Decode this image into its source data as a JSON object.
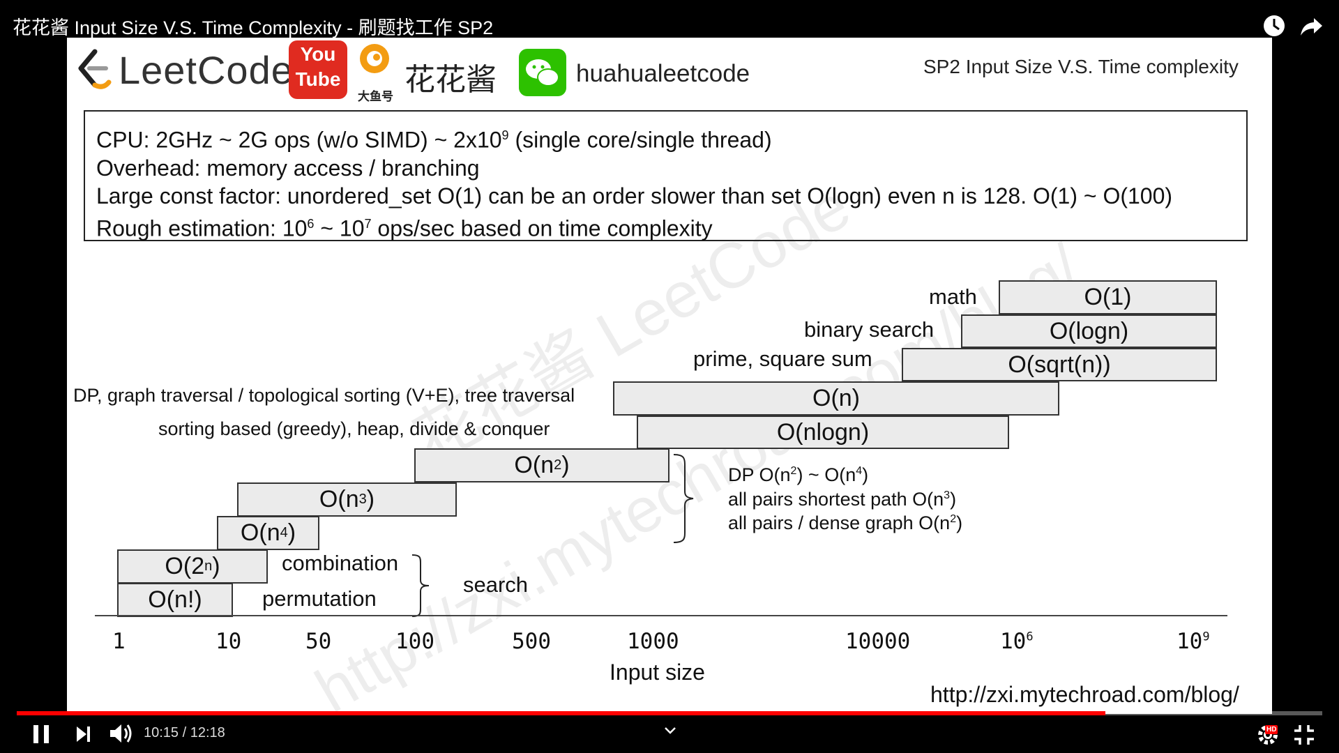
{
  "video": {
    "title": "花花酱 Input Size V.S. Time Complexity - 刷题找工作 SP2",
    "current_time": "10:15",
    "duration": "12:18",
    "time_separator": "/",
    "progress": 0.834,
    "hd_badge": "HD",
    "icons": [
      "watch-later-icon",
      "share-icon",
      "pause-icon",
      "next-icon",
      "volume-icon",
      "chevron-down-icon",
      "settings-icon",
      "exit-fullscreen-icon"
    ]
  },
  "slide": {
    "logo_text": "LeetCode",
    "youtube_top": "You",
    "youtube_bottom": "Tube",
    "douyu_label": "大鱼号",
    "author_name": "花花酱",
    "wechat_id": "huahualeetcode",
    "slide_title": "SP2 Input Size V.S. Time complexity",
    "info": {
      "line1_pre": "CPU: 2GHz ~ 2G ops (w/o SIMD) ~ 2x10",
      "line1_sup": "9",
      "line1_post": " (single core/single thread)",
      "line2": "Overhead: memory access / branching",
      "line3": "Large const factor: unordered_set O(1) can be an order slower than set O(logn) even n is 128. O(1) ~ O(100)",
      "line4_a": "Rough estimation: 10",
      "line4_sup1": "6",
      "line4_b": " ~ 10",
      "line4_sup2": "7",
      "line4_c": " ops/sec based on time complexity"
    },
    "complexities": {
      "o1": "O(1)",
      "ologn": "O(logn)",
      "osqrt": "O(sqrt(n))",
      "on": "O(n)",
      "onlogn": "O(nlogn)",
      "on2_base": "O(n",
      "on2_sup": "2",
      "on2_close": ")",
      "on3_base": "O(n",
      "on3_sup": "3",
      "on3_close": ")",
      "on4_base": "O(n",
      "on4_sup": "4",
      "on4_close": ")",
      "o2n_base": "O(2",
      "o2n_sup": "n",
      "o2n_close": ")",
      "ofact": "O(n!)"
    },
    "labels": {
      "math": "math",
      "binary_search": "binary search",
      "prime": "prime, square sum",
      "dp_graph": "DP, graph traversal / topological sorting (V+E), tree traversal",
      "sorting": "sorting based (greedy), heap, divide & conquer",
      "combination": "combination",
      "permutation": "permutation",
      "search": "search"
    },
    "notes": {
      "n1_a": "DP O(n",
      "n1_sup1": "2",
      "n1_b": ") ~ O(n",
      "n1_sup2": "4",
      "n1_c": ")",
      "n2_a": "all pairs shortest path O(n",
      "n2_sup": "3",
      "n2_b": ")",
      "n3_a": "all pairs / dense graph O(n",
      "n3_sup": "2",
      "n3_b": ")"
    },
    "axis": {
      "ticks": [
        "1",
        "10",
        "50",
        "100",
        "500",
        "1000",
        "10000"
      ],
      "tick_1e6_base": "10",
      "tick_1e6_sup": "6",
      "tick_1e9_base": "10",
      "tick_1e9_sup": "9",
      "label": "Input size"
    },
    "url": "http://zxi.mytechroad.com/blog/",
    "watermarks": [
      "花花酱 LeetCode",
      "http://zxi.mytechroad.com/blog/"
    ]
  }
}
